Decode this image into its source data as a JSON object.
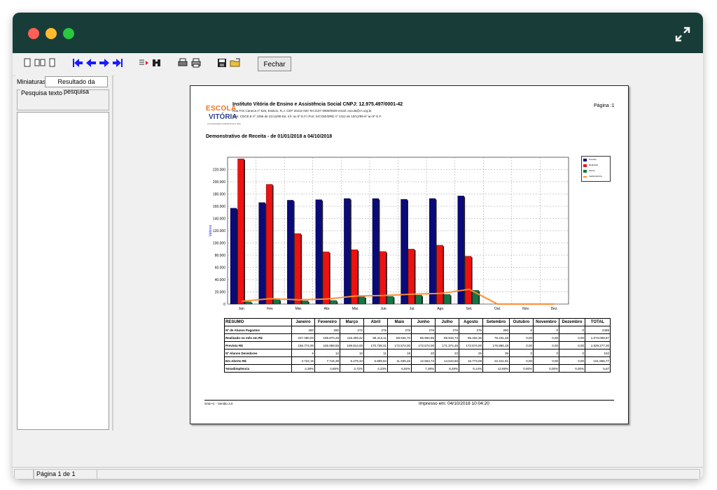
{
  "colors": {
    "titlebar": "#183d38",
    "previsto": "#0a0a7a",
    "realizado": "#ee1111",
    "aberto": "#117744",
    "inadimplencia": "#ff8c33"
  },
  "toolbar": {
    "icons": [
      "single-page-icon",
      "two-pages-icon",
      "multi-page-icon",
      "first-page-icon",
      "previous-page-icon",
      "next-page-icon",
      "last-page-icon",
      "find-next-icon",
      "find-icon",
      "print-setup-icon",
      "print-icon",
      "save-icon",
      "open-icon"
    ],
    "close_label": "Fechar"
  },
  "left": {
    "tab_thumbnails": "Miniaturas",
    "tab_search_results": "Resultado da pesquisa",
    "search_label": "Pesquisa texto"
  },
  "report": {
    "logo_top": "ESCOLA",
    "logo_bottom": "VITÓRIA",
    "logo_tagline": "Uma Educação Voltada Para a Vida",
    "institution": "Instituto Vitória de Ensino e Assistência Social CNPJ: 12.975.497/0001-42",
    "address": "Rua Frei Caneca nº 525, Estácio, R.J. CEP 20211-020 Tel 2107-0909/0929 email: escola@i-t.org.br",
    "authorization": "Port. CDCE.E nº 1056 de 21/12/90-Ed. Inf. ao 5º E.F./ Port. E/COIE/DRE nº 1312 de 10/12/99-6º ao 9º E.F.",
    "page": "Página :1",
    "title": "Demonstrativo de Receita - de 01/01/2018 a 04/10/2018",
    "footer_version": "SAE+C - Versão 3.0",
    "printed": "Impresso em: 04/10/2018 10:04:20"
  },
  "chart_data": {
    "type": "bar",
    "categories": [
      "Jan.",
      "Fev.",
      "Mar.",
      "Abr.",
      "Mai.",
      "Jun.",
      "Jul.",
      "Ago.",
      "Set.",
      "Out.",
      "Nov.",
      "Dez."
    ],
    "ylabel": "Valores",
    "ylim": [
      0,
      240000
    ],
    "yticks": [
      0,
      20000,
      40000,
      60000,
      80000,
      100000,
      120000,
      140000,
      160000,
      180000,
      200000,
      220000
    ],
    "ytick_labels": [
      "0",
      "20.000",
      "40.000",
      "60.000",
      "80.000",
      "100.000",
      "120.000",
      "140.000",
      "160.000",
      "180.000",
      "200.000",
      "220.000"
    ],
    "grid": true,
    "legend": "top-right",
    "series": [
      {
        "name": "Previsto",
        "type": "bar",
        "values": [
          156774,
          165959,
          169814,
          170738,
          172574,
          172574,
          171374,
          172574,
          176886,
          0,
          0,
          0
        ]
      },
      {
        "name": "Realizado",
        "type": "bar",
        "values": [
          237480,
          195870,
          115309,
          85413,
          88946,
          85994,
          89919,
          96332,
          78231,
          0,
          0,
          0
        ]
      },
      {
        "name": "Aberto",
        "type": "bar",
        "values": [
          3722,
          7716,
          5279,
          5869,
          11935,
          12563,
          14543,
          15773,
          22441,
          0,
          0,
          0
        ]
      },
      {
        "name": "Inadimplência",
        "type": "line",
        "values": [
          2.38,
          4.65,
          3.72,
          4.33,
          6.92,
          7.38,
          8.49,
          9.14,
          12.69,
          0,
          0,
          0
        ]
      }
    ]
  },
  "summary": {
    "headers": [
      "RESUMO",
      "Janeiro",
      "Fevereiro",
      "Março",
      "Abril",
      "Maio",
      "Junho",
      "Julho",
      "Agosto",
      "Setembro",
      "Outubro",
      "Novembro",
      "Dezembro",
      "TOTAL"
    ],
    "rows": [
      [
        "Nº de Alunos Pagantes",
        "280",
        "280",
        "272",
        "276",
        "276",
        "276",
        "276",
        "276",
        "280",
        "0",
        "0",
        "0",
        "2489"
      ],
      [
        "Realizado no mês em R$",
        "237.480,00",
        "195.870,28",
        "115.309,42",
        "85.413,11",
        "88.946,70",
        "85.994,86",
        "89.919,73",
        "96.332,36",
        "78.231,48",
        "0,00",
        "0,00",
        "0,00",
        "1.073.008,87"
      ],
      [
        "Previsto R$",
        "156.774,00",
        "165.959,59",
        "169.814,00",
        "170.738,31",
        "172.574,00",
        "172.574,00",
        "171.374,48",
        "172.574,00",
        "176.886,19",
        "0,00",
        "0,00",
        "0,00",
        "1.529.277,30"
      ],
      [
        "Nº Alunos Devedores",
        "6",
        "12",
        "10",
        "11",
        "19",
        "20",
        "23",
        "25",
        "35",
        "0",
        "0",
        "0",
        "152"
      ],
      [
        "Em Aberto R$",
        "3.722,19",
        "7.716,38",
        "5.279,33",
        "5.869,94",
        "11.935,46",
        "12.563,72",
        "14.543,60",
        "15.773,08",
        "22.441,91",
        "0,00",
        "0,00",
        "0,00",
        "101.866,77"
      ],
      [
        "%Inadimplencia",
        "2,38%",
        "4,65%",
        "3,72%",
        "4,33%",
        "6,92%",
        "7,38%",
        "8,49%",
        "9,14%",
        "12,69%",
        "0,00%",
        "0,00%",
        "0,00%",
        "5,67"
      ]
    ]
  },
  "status": {
    "page_info": "Página 1 de 1"
  }
}
